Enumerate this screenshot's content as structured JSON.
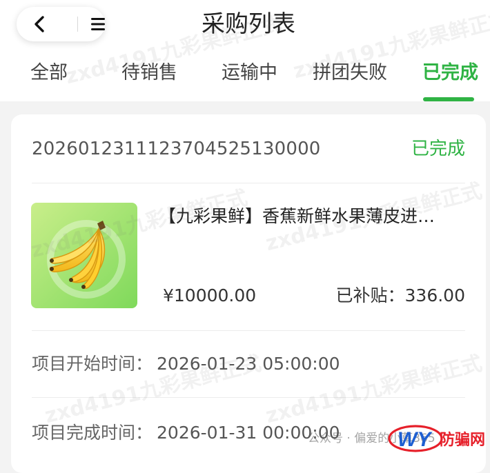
{
  "header": {
    "title": "采购列表",
    "back_icon": "chevron-left-icon",
    "menu_icon": "hamburger-menu-icon"
  },
  "tabs": [
    {
      "label": "全部",
      "active": false
    },
    {
      "label": "待销售",
      "active": false
    },
    {
      "label": "运输中",
      "active": false
    },
    {
      "label": "拼团失败",
      "active": false
    },
    {
      "label": "已完成",
      "active": true
    }
  ],
  "order": {
    "number": "2026012311123704525130000",
    "status": "已完成",
    "product": {
      "image_icon": "banana-product-image",
      "name": "【九彩果鲜】香蕉新鲜水果薄皮进…",
      "price": "¥10000.00",
      "subsidy_label": "已补贴：",
      "subsidy_value": "336.00"
    },
    "start_time_label": "项目开始时间：",
    "start_time_value": "2026-01-23 05:00:00",
    "end_time_label": "项目完成时间：",
    "end_time_value": "2026-01-31 00:00:00"
  },
  "watermark": {
    "text": "zxd4191九彩果鲜正式"
  },
  "footer": {
    "credit": "公众号 · 偏爱的小草365",
    "logo_text_latin": "WY",
    "logo_text_cn": "防骗网"
  },
  "colors": {
    "accent": "#2fb344",
    "logo_red": "#e6202a",
    "logo_blue": "#1e5fd1"
  }
}
